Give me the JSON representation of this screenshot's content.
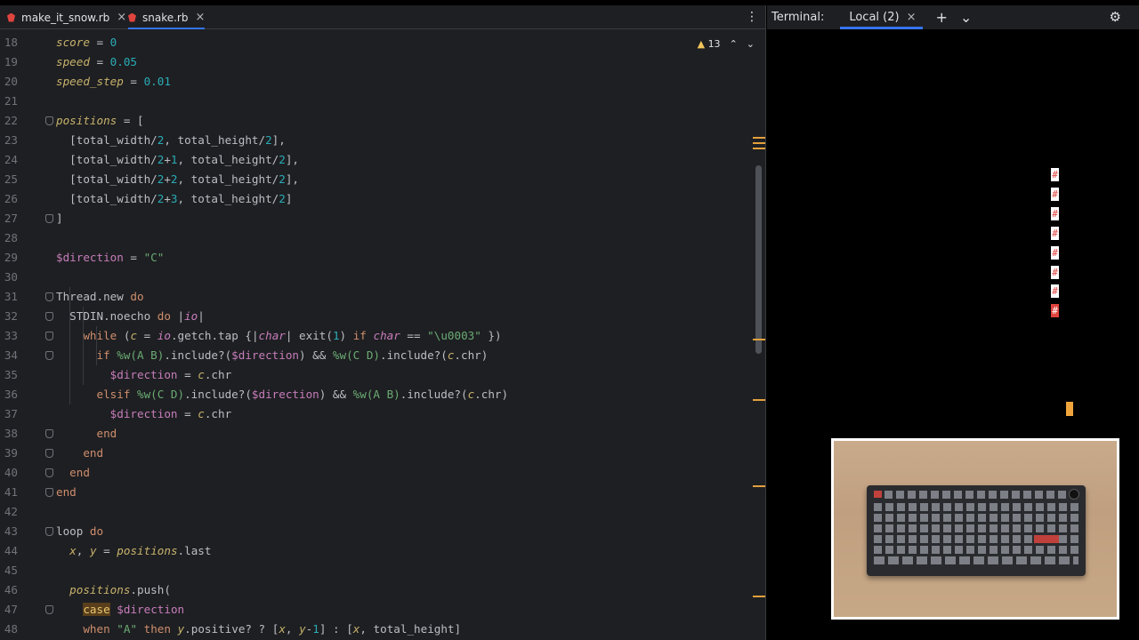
{
  "editor": {
    "tabs": [
      {
        "label": "make_it_snow.rb",
        "active": false
      },
      {
        "label": "snake.rb",
        "active": true
      }
    ],
    "inspection_count": "13",
    "lines": [
      {
        "n": "18",
        "html": "<span class=\"lv\">score</span> = <span class=\"n\">0</span>"
      },
      {
        "n": "19",
        "html": "<span class=\"lv\">speed</span> = <span class=\"n\">0.05</span>"
      },
      {
        "n": "20",
        "html": "<span class=\"lv\">speed_step</span> = <span class=\"n\">0.01</span>"
      },
      {
        "n": "21",
        "html": ""
      },
      {
        "n": "22",
        "html": "<span class=\"lv\">positions</span> = [",
        "fold": true
      },
      {
        "n": "23",
        "html": "  [total_width/<span class=\"n\">2</span>, total_height/<span class=\"n\">2</span>],"
      },
      {
        "n": "24",
        "html": "  [total_width/<span class=\"n\">2</span>+<span class=\"n\">1</span>, total_height/<span class=\"n\">2</span>],"
      },
      {
        "n": "25",
        "html": "  [total_width/<span class=\"n\">2</span>+<span class=\"n\">2</span>, total_height/<span class=\"n\">2</span>],"
      },
      {
        "n": "26",
        "html": "  [total_width/<span class=\"n\">2</span>+<span class=\"n\">3</span>, total_height/<span class=\"n\">2</span>]"
      },
      {
        "n": "27",
        "html": "]",
        "fold": true
      },
      {
        "n": "28",
        "html": ""
      },
      {
        "n": "29",
        "html": "<span class=\"g\">$direction</span> = <span class=\"s\">\"C\"</span>"
      },
      {
        "n": "30",
        "html": ""
      },
      {
        "n": "31",
        "html": "Thread.new <span class=\"k\">do</span>",
        "fold": true
      },
      {
        "n": "32",
        "html": "  STDIN.noecho <span class=\"k\">do</span> |<span class=\"i\">io</span>|",
        "fold": true
      },
      {
        "n": "33",
        "html": "    <span class=\"k\">while</span> (<span class=\"lv\">c</span> = <span class=\"i\">io</span>.getch.tap {|<span class=\"i\">char</span>| exit(<span class=\"n\">1</span>) <span class=\"k\">if</span> <span class=\"i\">char</span> == <span class=\"s\">\"\\u0003\"</span> })",
        "fold": true
      },
      {
        "n": "34",
        "html": "      <span class=\"k\">if</span> <span class=\"s\">%w(A B)</span>.include?(<span class=\"g\">$direction</span>) &amp;&amp; <span class=\"s\">%w(C D)</span>.include?(<span class=\"lv\">c</span>.chr)",
        "fold": true
      },
      {
        "n": "35",
        "html": "        <span class=\"g\">$direction</span> = <span class=\"lv\">c</span>.chr"
      },
      {
        "n": "36",
        "html": "      <span class=\"k\">elsif</span> <span class=\"s\">%w(C D)</span>.include?(<span class=\"g\">$direction</span>) &amp;&amp; <span class=\"s\">%w(A B)</span>.include?(<span class=\"lv\">c</span>.chr)"
      },
      {
        "n": "37",
        "html": "        <span class=\"g\">$direction</span> = <span class=\"lv\">c</span>.chr"
      },
      {
        "n": "38",
        "html": "      <span class=\"k\">end</span>",
        "fold": true
      },
      {
        "n": "39",
        "html": "    <span class=\"k\">end</span>",
        "fold": true
      },
      {
        "n": "40",
        "html": "  <span class=\"k\">end</span>",
        "fold": true
      },
      {
        "n": "41",
        "html": "<span class=\"k\">end</span>",
        "fold": true
      },
      {
        "n": "42",
        "html": ""
      },
      {
        "n": "43",
        "html": "loop <span class=\"k\">do</span>",
        "fold": true
      },
      {
        "n": "44",
        "html": "  <span class=\"lv\">x</span>, <span class=\"lv\">y</span> = <span class=\"lv\">positions</span>.last"
      },
      {
        "n": "45",
        "html": ""
      },
      {
        "n": "46",
        "html": "  <span class=\"lv\">positions</span>.push("
      },
      {
        "n": "47",
        "html": "    <span class=\"hl\">case</span> <span class=\"g\">$direction</span>",
        "fold": true
      },
      {
        "n": "48",
        "html": "    <span class=\"k\">when</span> <span class=\"s\">\"A\"</span> <span class=\"k\">then</span> <span class=\"lv\">y</span>.positive? ? [<span class=\"lv\">x</span>, <span class=\"lv\">y</span>-<span class=\"n\">1</span>] : [<span class=\"lv\">x</span>, total_height]"
      }
    ]
  },
  "terminal": {
    "title": "Terminal:",
    "tab_label": "Local (2)",
    "snake": [
      "#",
      "#",
      "#",
      "#",
      "#",
      "#",
      "#",
      "#"
    ]
  },
  "icons": {
    "tab_file": "ruby-file-icon",
    "close": "close-icon",
    "warning": "warning-icon",
    "gear": "gear-icon"
  },
  "colors": {
    "accent": "#3574f0",
    "warning": "#f2c55c",
    "ruby": "#e0443e"
  }
}
